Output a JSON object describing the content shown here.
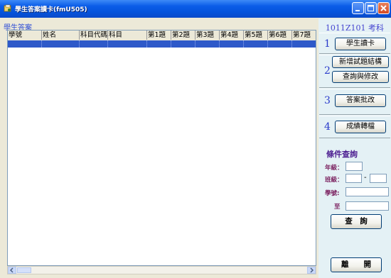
{
  "window": {
    "title": "學生答案讀卡(fmU505)",
    "title_color": "#0553DB"
  },
  "grid": {
    "group_label": "學生答案",
    "columns": [
      "學號",
      "姓名",
      "科目代碼",
      "科目",
      "第1題",
      "第2題",
      "第3題",
      "第4題",
      "第5題",
      "第6題",
      "第7題"
    ],
    "selected_row_color": "#2E59C9"
  },
  "panel": {
    "exam_code": "1011Z101  考科",
    "steps": [
      {
        "num": "1",
        "buttons": [
          "學生讀卡"
        ]
      },
      {
        "num": "2",
        "buttons": [
          "新增試題結構",
          "查詢與修改"
        ]
      },
      {
        "num": "3",
        "buttons": [
          "答案批改"
        ]
      },
      {
        "num": "4",
        "buttons": [
          "成績轉檔"
        ]
      }
    ],
    "query": {
      "title": "條件查詢",
      "grade_label": "年級：",
      "class_label": "班級：",
      "class_sep": "-",
      "student_label": "學號:",
      "to_label": "至",
      "search_button": "查　詢",
      "exit_button": "離　　開"
    }
  }
}
